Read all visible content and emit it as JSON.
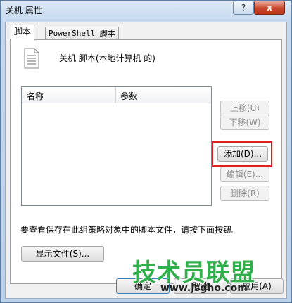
{
  "window": {
    "title": "关机 属性",
    "help_label": "?",
    "close_label": "x"
  },
  "tabs": [
    {
      "label": "脚本"
    },
    {
      "label": "PowerShell 脚本"
    }
  ],
  "header": {
    "text": "关机 脚本(本地计算机 的)"
  },
  "list": {
    "columns": [
      "名称",
      "参数"
    ]
  },
  "side_buttons": {
    "up": "上移(U)",
    "down": "下移(W)",
    "add": "添加(D)...",
    "edit": "编辑(E)...",
    "remove": "删除(R)"
  },
  "info_text": "要查看保存在此组策略对象中的脚本文件，请按下面按钮。",
  "show_files_label": "显示文件(S)...",
  "footer": {
    "ok": "确定",
    "cancel": "取消",
    "apply": "应用(A)"
  },
  "watermark": {
    "logo_text": "技术员联盟",
    "url": "www.jsgho.com"
  },
  "colors": {
    "highlight": "#e02020",
    "watermark": "#2fb04a"
  }
}
